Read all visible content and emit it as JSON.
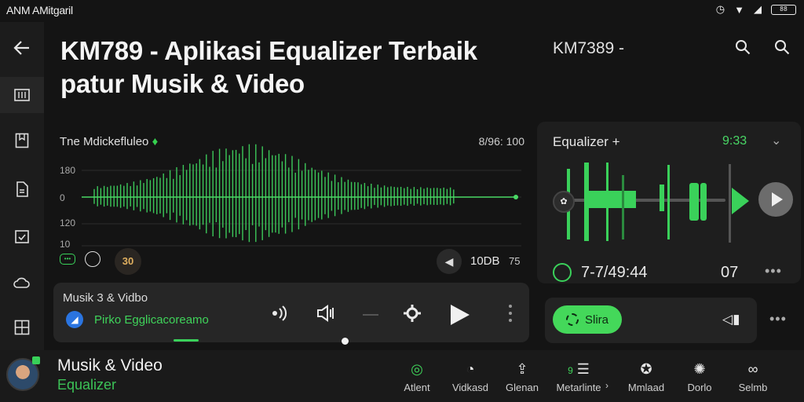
{
  "status_bar": {
    "carrier": "ANM AMitgaril",
    "battery": "88"
  },
  "sidebar": {
    "items": [
      {
        "name": "back",
        "icon": "arrow-left-icon"
      },
      {
        "name": "library",
        "icon": "grid-icon"
      },
      {
        "name": "bookmark",
        "icon": "bookmark-icon"
      },
      {
        "name": "document",
        "icon": "document-icon"
      },
      {
        "name": "calendar",
        "icon": "calendar-check-icon"
      },
      {
        "name": "cloud",
        "icon": "cloud-icon"
      },
      {
        "name": "dashboard",
        "icon": "dashboard-icon"
      }
    ]
  },
  "header": {
    "title_line1": "KM789 - Aplikasi Equalizer Terbaik",
    "title_line2": "patur Musik & Video",
    "app_label": "KM7389 -"
  },
  "waveform": {
    "title": "Tne Mdickefluleo",
    "count": "8/96: 100",
    "yticks": [
      "180",
      "0",
      "120",
      "10"
    ],
    "badge": "30",
    "db_label": "10DB",
    "db_suffix": "75"
  },
  "player": {
    "title": "Musik 3 & Vidbo",
    "subtitle": "Pirko Egglicacoreamo",
    "progress": 0.05
  },
  "equalizer": {
    "title": "Equalizer +",
    "time": "9:33",
    "readout": "7-7/49:44",
    "counter": "07"
  },
  "actions": {
    "share_label": "Slira"
  },
  "now_playing": {
    "title": "Musik & Video",
    "subtitle": "Equalizer"
  },
  "bottom_nav": [
    {
      "label": "Atlent",
      "icon": "search-circle-icon"
    },
    {
      "label": "Vidkasd",
      "icon": "clock-icon"
    },
    {
      "label": "Glenan",
      "icon": "person-upload-icon"
    },
    {
      "label": "Metarlinte",
      "icon": "list-icon",
      "badge": "9"
    },
    {
      "label": "Mmlaad",
      "icon": "globe-icon"
    },
    {
      "label": "Dorlo",
      "icon": "settings-icon"
    },
    {
      "label": "Selmb",
      "icon": "link-icon"
    }
  ],
  "colors": {
    "accent": "#3fd35a",
    "background": "#141414",
    "card": "#262626",
    "blue": "#2a74e0"
  }
}
